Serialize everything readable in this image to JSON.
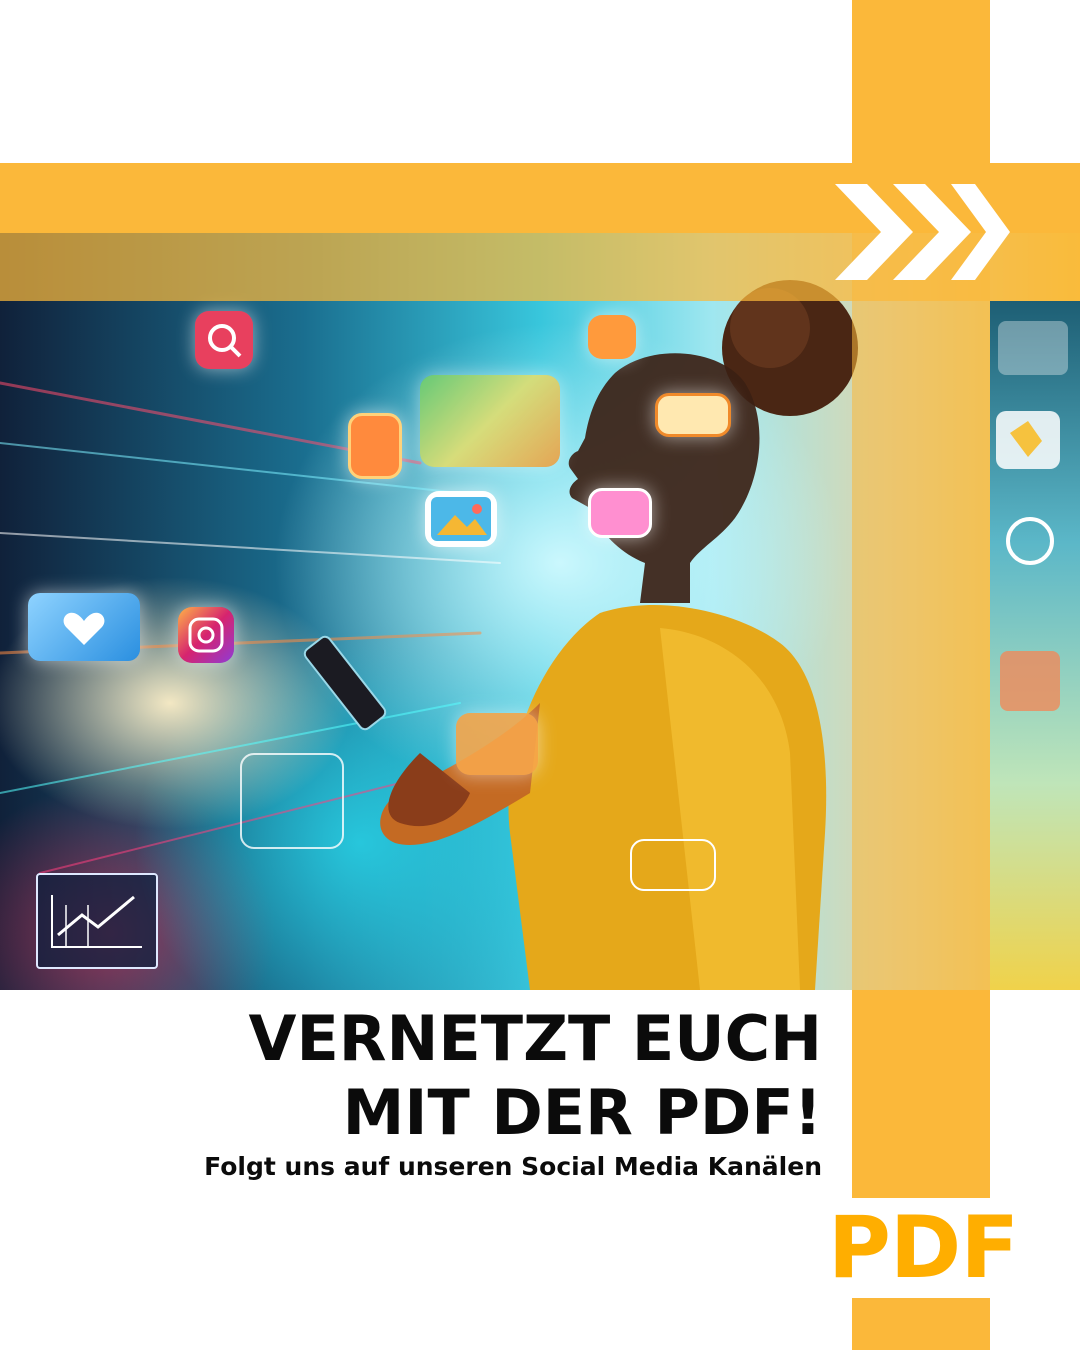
{
  "headline": {
    "line1": "VERNETZT EUCH",
    "line2": "MIT DER PDF!"
  },
  "subline": "Folgt uns auf unseren Social Media Kanälen",
  "logo": "PDF",
  "colors": {
    "accent": "#fbb83a",
    "logo": "#ffae00",
    "text": "#0b0b0b",
    "background": "#ffffff"
  },
  "icons": [
    "chevron-right-icon",
    "chevron-right-icon",
    "heart-icon",
    "instagram-icon",
    "chart-icon",
    "at-icon"
  ]
}
